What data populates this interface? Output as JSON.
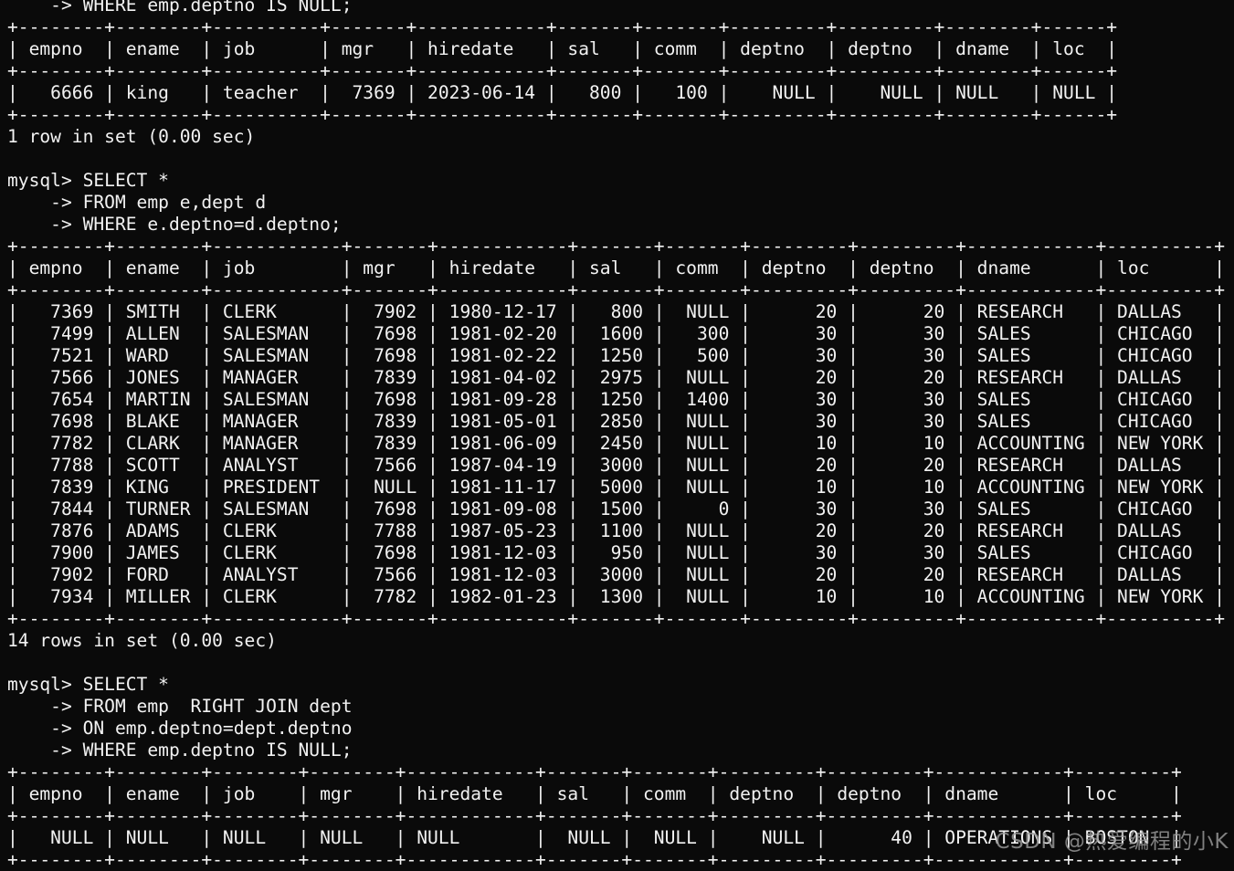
{
  "terminal": {
    "prompt": "mysql> ",
    "continuation": "    -> ",
    "colors": {
      "background": "#0a0a0a",
      "foreground": "#f2f2f2",
      "watermark": "#9a9a9a"
    }
  },
  "watermark": {
    "text": "CSDN @热爱编程的小K"
  },
  "blocks": [
    {
      "id": "block-0-tail",
      "kind": "query-tail",
      "lines": [
        "    -> WHERE emp.deptno IS NULL;"
      ]
    },
    {
      "id": "result-0",
      "kind": "result-table",
      "columns": [
        "empno",
        "ename",
        "job",
        "mgr",
        "hiredate",
        "sal",
        "comm",
        "deptno",
        "deptno",
        "dname",
        "loc"
      ],
      "widths": [
        6,
        6,
        8,
        5,
        10,
        5,
        5,
        7,
        7,
        6,
        4
      ],
      "aligns": [
        "right",
        "left",
        "left",
        "right",
        "left",
        "right",
        "right",
        "right",
        "right",
        "left",
        "left"
      ],
      "rows": [
        [
          "6666",
          "king",
          "teacher",
          "7369",
          "2023-06-14",
          "800",
          "100",
          "NULL",
          "NULL",
          "NULL",
          "NULL"
        ]
      ],
      "status": "1 row in set (0.00 sec)"
    },
    {
      "id": "query-1",
      "kind": "query",
      "lines": [
        "mysql> SELECT *",
        "    -> FROM emp e,dept d",
        "    -> WHERE e.deptno=d.deptno;"
      ]
    },
    {
      "id": "result-1",
      "kind": "result-table",
      "columns": [
        "empno",
        "ename",
        "job",
        "mgr",
        "hiredate",
        "sal",
        "comm",
        "deptno",
        "deptno",
        "dname",
        "loc"
      ],
      "widths": [
        6,
        6,
        10,
        5,
        10,
        5,
        5,
        7,
        7,
        10,
        8
      ],
      "aligns": [
        "right",
        "left",
        "left",
        "right",
        "left",
        "right",
        "right",
        "right",
        "right",
        "left",
        "left"
      ],
      "rows": [
        [
          "7369",
          "SMITH",
          "CLERK",
          "7902",
          "1980-12-17",
          "800",
          "NULL",
          "20",
          "20",
          "RESEARCH",
          "DALLAS"
        ],
        [
          "7499",
          "ALLEN",
          "SALESMAN",
          "7698",
          "1981-02-20",
          "1600",
          "300",
          "30",
          "30",
          "SALES",
          "CHICAGO"
        ],
        [
          "7521",
          "WARD",
          "SALESMAN",
          "7698",
          "1981-02-22",
          "1250",
          "500",
          "30",
          "30",
          "SALES",
          "CHICAGO"
        ],
        [
          "7566",
          "JONES",
          "MANAGER",
          "7839",
          "1981-04-02",
          "2975",
          "NULL",
          "20",
          "20",
          "RESEARCH",
          "DALLAS"
        ],
        [
          "7654",
          "MARTIN",
          "SALESMAN",
          "7698",
          "1981-09-28",
          "1250",
          "1400",
          "30",
          "30",
          "SALES",
          "CHICAGO"
        ],
        [
          "7698",
          "BLAKE",
          "MANAGER",
          "7839",
          "1981-05-01",
          "2850",
          "NULL",
          "30",
          "30",
          "SALES",
          "CHICAGO"
        ],
        [
          "7782",
          "CLARK",
          "MANAGER",
          "7839",
          "1981-06-09",
          "2450",
          "NULL",
          "10",
          "10",
          "ACCOUNTING",
          "NEW YORK"
        ],
        [
          "7788",
          "SCOTT",
          "ANALYST",
          "7566",
          "1987-04-19",
          "3000",
          "NULL",
          "20",
          "20",
          "RESEARCH",
          "DALLAS"
        ],
        [
          "7839",
          "KING",
          "PRESIDENT",
          "NULL",
          "1981-11-17",
          "5000",
          "NULL",
          "10",
          "10",
          "ACCOUNTING",
          "NEW YORK"
        ],
        [
          "7844",
          "TURNER",
          "SALESMAN",
          "7698",
          "1981-09-08",
          "1500",
          "0",
          "30",
          "30",
          "SALES",
          "CHICAGO"
        ],
        [
          "7876",
          "ADAMS",
          "CLERK",
          "7788",
          "1987-05-23",
          "1100",
          "NULL",
          "20",
          "20",
          "RESEARCH",
          "DALLAS"
        ],
        [
          "7900",
          "JAMES",
          "CLERK",
          "7698",
          "1981-12-03",
          "950",
          "NULL",
          "30",
          "30",
          "SALES",
          "CHICAGO"
        ],
        [
          "7902",
          "FORD",
          "ANALYST",
          "7566",
          "1981-12-03",
          "3000",
          "NULL",
          "20",
          "20",
          "RESEARCH",
          "DALLAS"
        ],
        [
          "7934",
          "MILLER",
          "CLERK",
          "7782",
          "1982-01-23",
          "1300",
          "NULL",
          "10",
          "10",
          "ACCOUNTING",
          "NEW YORK"
        ]
      ],
      "status": "14 rows in set (0.00 sec)"
    },
    {
      "id": "query-2",
      "kind": "query",
      "lines": [
        "mysql> SELECT *",
        "    -> FROM emp  RIGHT JOIN dept",
        "    -> ON emp.deptno=dept.deptno",
        "    -> WHERE emp.deptno IS NULL;"
      ]
    },
    {
      "id": "result-2",
      "kind": "result-table",
      "columns": [
        "empno",
        "ename",
        "job",
        "mgr",
        "hiredate",
        "sal",
        "comm",
        "deptno",
        "deptno",
        "dname",
        "loc"
      ],
      "widths": [
        6,
        6,
        6,
        6,
        10,
        5,
        5,
        7,
        7,
        10,
        7
      ],
      "aligns": [
        "right",
        "left",
        "left",
        "left",
        "left",
        "right",
        "right",
        "right",
        "right",
        "left",
        "left"
      ],
      "rows": [
        [
          "NULL",
          "NULL",
          "NULL",
          "NULL",
          "NULL",
          "NULL",
          "NULL",
          "NULL",
          "40",
          "OPERATIONS",
          "BOSTON"
        ]
      ],
      "status": ""
    }
  ]
}
